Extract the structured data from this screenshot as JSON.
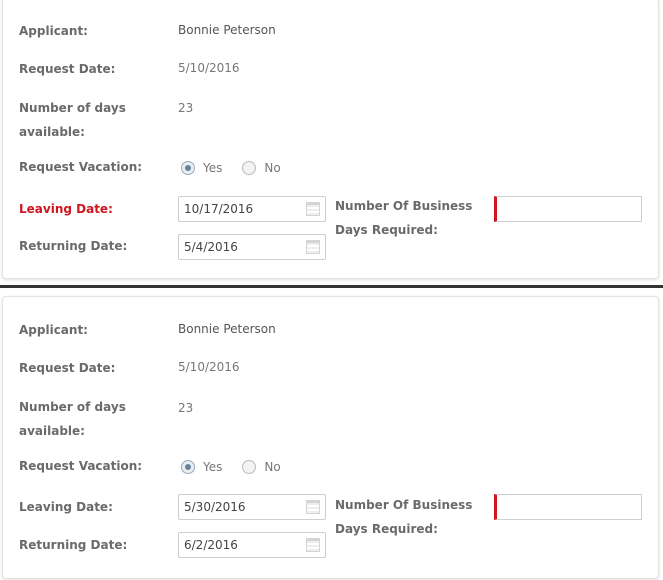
{
  "forms": [
    {
      "applicant_label": "Applicant:",
      "applicant_value": "Bonnie Peterson",
      "request_date_label": "Request Date:",
      "request_date_value": "5/10/2016",
      "days_available_label_line1": "Number of days",
      "days_available_label_line2": "available:",
      "days_available_value": "23",
      "request_vacation_label": "Request Vacation:",
      "yes_label": "Yes",
      "no_label": "No",
      "selected_option": "Yes",
      "leaving_date_label": "Leaving Date:",
      "leaving_date_value": "10/17/2016",
      "leaving_date_error": true,
      "returning_date_label": "Returning Date:",
      "returning_date_value": "5/4/2016",
      "business_days_label_line1": "Number Of Business",
      "business_days_label_line2": "Days Required:",
      "business_days_value": ""
    },
    {
      "applicant_label": "Applicant:",
      "applicant_value": "Bonnie Peterson",
      "request_date_label": "Request Date:",
      "request_date_value": "5/10/2016",
      "days_available_label_line1": "Number of days",
      "days_available_label_line2": "available:",
      "days_available_value": "23",
      "request_vacation_label": "Request Vacation:",
      "yes_label": "Yes",
      "no_label": "No",
      "selected_option": "Yes",
      "leaving_date_label": "Leaving Date:",
      "leaving_date_value": "5/30/2016",
      "leaving_date_error": false,
      "returning_date_label": "Returning Date:",
      "returning_date_value": "6/2/2016",
      "business_days_label_line1": "Number Of Business",
      "business_days_label_line2": "Days Required:",
      "business_days_value": ""
    }
  ],
  "colors": {
    "error": "#d0161e",
    "label": "#6a6a6a",
    "divider": "#333333"
  }
}
